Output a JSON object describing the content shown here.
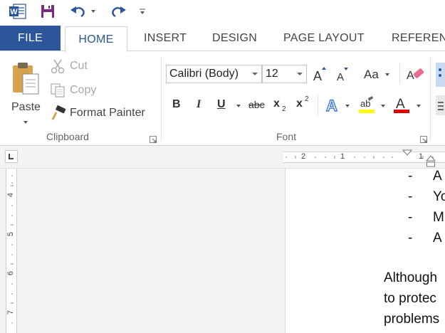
{
  "quick_access": {
    "app_icon": "word-icon",
    "save_icon": "save-icon",
    "undo_icon": "undo-icon",
    "redo_icon": "redo-icon",
    "customize_icon": "customize-qat-icon"
  },
  "tabs": [
    {
      "label": "FILE"
    },
    {
      "label": "HOME"
    },
    {
      "label": "INSERT"
    },
    {
      "label": "DESIGN"
    },
    {
      "label": "PAGE LAYOUT"
    },
    {
      "label": "REFERENC"
    }
  ],
  "clipboard": {
    "paste_label": "Paste",
    "cut_label": "Cut",
    "copy_label": "Copy",
    "format_painter_label": "Format Painter",
    "group_label": "Clipboard"
  },
  "font": {
    "font_name": "Calibri (Body)",
    "font_size": "12",
    "change_case_label": "Aa",
    "bold_label": "B",
    "italic_label": "I",
    "underline_label": "U",
    "strike_label": "abc",
    "subscript_label": "x",
    "subscript_sub": "2",
    "superscript_label": "x",
    "superscript_sup": "2",
    "group_label": "Font",
    "highlight_color": "#ffff00",
    "font_color": "#e00000"
  },
  "ruler": {
    "horizontal_numbers": [
      "2",
      "1",
      "1"
    ],
    "vertical_numbers": [
      "4",
      "5",
      "6",
      "7"
    ]
  },
  "document": {
    "bullets": [
      {
        "dash": "-",
        "text": "A"
      },
      {
        "dash": "-",
        "text": "Yo"
      },
      {
        "dash": "-",
        "text": "M"
      },
      {
        "dash": "-",
        "text": "A"
      }
    ],
    "paragraph": [
      "Although",
      "to protec",
      "problems"
    ]
  },
  "colors": {
    "accent": "#2b579a",
    "word_blue": "#2b579a"
  }
}
